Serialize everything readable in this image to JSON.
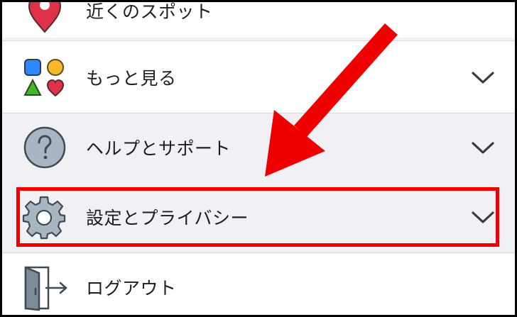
{
  "menu": {
    "items": [
      {
        "label": "近くのスポット",
        "icon": "location-pin-icon",
        "has_chevron": false
      },
      {
        "label": "もっと見る",
        "icon": "shapes-icon",
        "has_chevron": true
      },
      {
        "label": "ヘルプとサポート",
        "icon": "question-circle-icon",
        "has_chevron": true
      },
      {
        "label": "設定とプライバシー",
        "icon": "gear-icon",
        "has_chevron": true
      },
      {
        "label": "ログアウト",
        "icon": "door-exit-icon",
        "has_chevron": false
      }
    ]
  },
  "annotation": {
    "highlight_color": "#ee0000",
    "highlighted_item": "設定とプライバシー"
  }
}
